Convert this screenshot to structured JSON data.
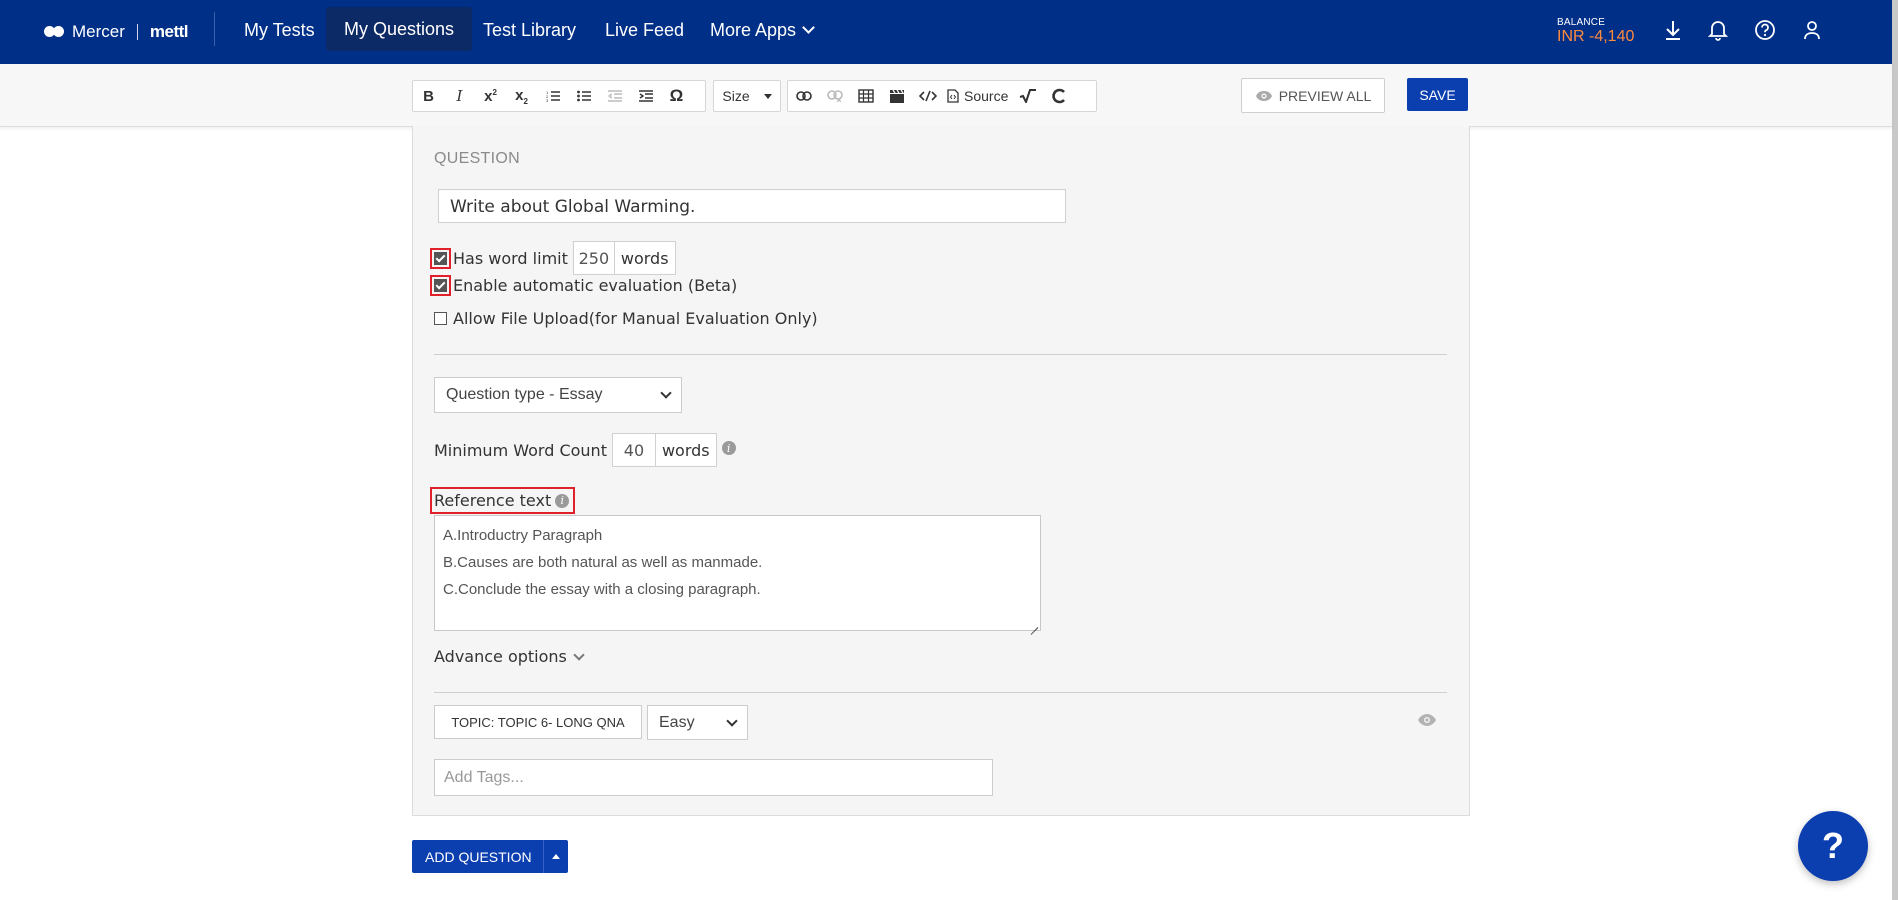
{
  "brand": {
    "left": "Mercer",
    "right": "mettl"
  },
  "nav": {
    "items": [
      "My Tests",
      "My Questions",
      "Test Library",
      "Live Feed",
      "More Apps"
    ],
    "active": "My Questions"
  },
  "balance": {
    "label": "BALANCE",
    "amount": "INR -4,140"
  },
  "toolbar": {
    "size_label": "Size",
    "source_label": "Source",
    "preview_label": "PREVIEW ALL",
    "save_label": "SAVE"
  },
  "question": {
    "section_label": "QUESTION",
    "text": "Write about Global Warming.",
    "word_limit": {
      "label": "Has word limit",
      "value": "250",
      "unit": "words",
      "checked": true
    },
    "auto_eval": {
      "label": "Enable automatic evaluation (Beta)",
      "checked": true
    },
    "file_upload": {
      "label": "Allow File Upload(for Manual Evaluation Only)",
      "checked": false
    },
    "type_select": "Question type - Essay",
    "min_word": {
      "label": "Minimum Word Count",
      "value": "40",
      "unit": "words"
    },
    "reference": {
      "label": "Reference text",
      "lines": [
        "A.Introductry Paragraph",
        "B.Causes are both natural as well as manmade.",
        "C.Conclude the essay with a closing paragraph."
      ]
    },
    "advance_label": "Advance options",
    "topic_label": "TOPIC: TOPIC 6- LONG QNA",
    "difficulty": "Easy",
    "tags_placeholder": "Add Tags..."
  },
  "add_question_label": "ADD QUESTION",
  "help_label": "?",
  "colors": {
    "nav_bg": "#002f87",
    "primary": "#0b3eaf",
    "balance": "#ff8a3c",
    "highlight": "#e0202a"
  }
}
